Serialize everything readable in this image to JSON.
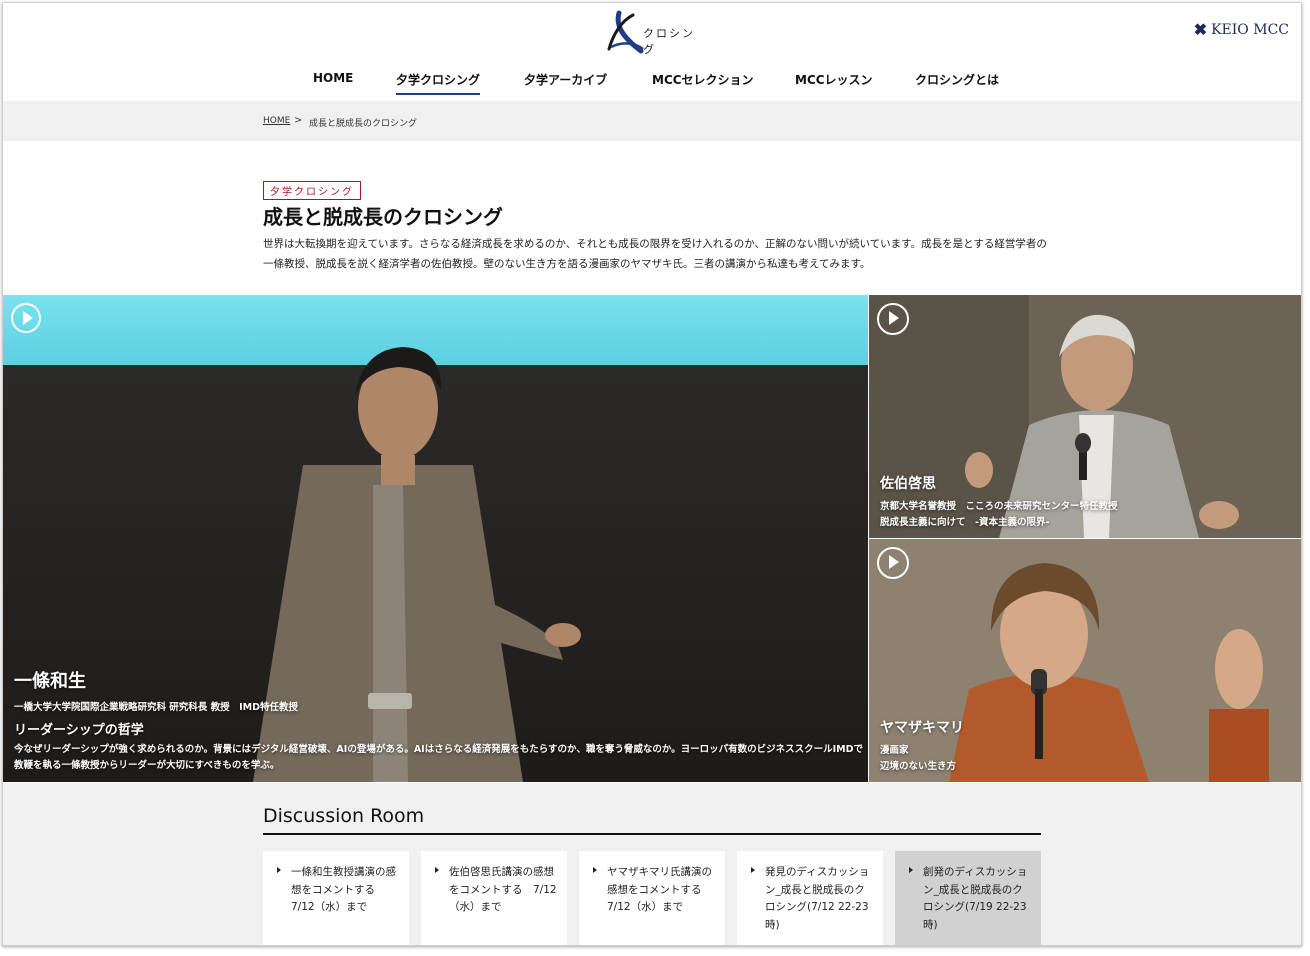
{
  "header": {
    "logo_text": "クロシング",
    "brand": "KEIO MCC",
    "nav": [
      {
        "label": "HOME",
        "active": false
      },
      {
        "label": "夕学クロシング",
        "active": true
      },
      {
        "label": "夕学アーカイブ",
        "active": false
      },
      {
        "label": "MCCセレクション",
        "active": false
      },
      {
        "label": "MCCレッスン",
        "active": false
      },
      {
        "label": "クロシングとは",
        "active": false
      }
    ]
  },
  "breadcrumb": {
    "home": "HOME",
    "separator": ">",
    "current": "成長と脱成長のクロシング"
  },
  "intro": {
    "category": "夕学クロシング",
    "title": "成長と脱成長のクロシング",
    "description": "世界は大転換期を迎えています。さらなる経済成長を求めるのか、それとも成長の限界を受け入れるのか、正解のない問いが続いています。成長を是とする経営学者の一條教授、脱成長を説く経済学者の佐伯教授。壁のない生き方を語る漫画家のヤマザキ氏。三者の講演から私達も考えてみます。"
  },
  "videos": {
    "main": {
      "name": "一條和生",
      "role": "一橋大学大学院国際企業戦略研究科 研究科長 教授　IMD特任教授",
      "talk": "リーダーシップの哲学",
      "description": "今なぜリーダーシップが強く求められるのか。背景にはデジタル経営破壊、AIの登場がある。AIはさらなる経済発展をもたらすのか、職を奪う脅威なのか。ヨーロッパ有数のビジネススクールIMDで教鞭を執る一條教授からリーダーが大切にすべきものを学ぶ。"
    },
    "saeki": {
      "name": "佐伯啓思",
      "role": "京都大学名誉教授　こころの未来研究センター特任教授",
      "talk": "脱成長主義に向けて　-資本主義の限界-"
    },
    "yamazaki": {
      "name": "ヤマザキマリ",
      "role": "漫画家",
      "talk": "辺境のない生き方"
    }
  },
  "discussion": {
    "title": "Discussion Room",
    "cards": [
      {
        "label": "一條和生教授講演の感想をコメントする　7/12（水）まで",
        "active": false
      },
      {
        "label": "佐伯啓思氏講演の感想をコメントする　7/12（水）まで",
        "active": false
      },
      {
        "label": "ヤマザキマリ氏講演の感想をコメントする　7/12（水）まで",
        "active": false
      },
      {
        "label": "発見のディスカッション_成長と脱成長のクロシング(7/12 22-23時)",
        "active": false
      },
      {
        "label": "創発のディスカッション_成長と脱成長のクロシング(7/19 22-23時)",
        "active": true
      }
    ]
  },
  "colors": {
    "nav_underline": "#1f3c87",
    "category_tag": "#a3142a",
    "gray_band": "#f0f0f0",
    "active_card": "#d1d1d1"
  },
  "icons": [
    "x-logo-icon",
    "keio-x-icon",
    "play-icon",
    "bullet-arrow-icon"
  ]
}
